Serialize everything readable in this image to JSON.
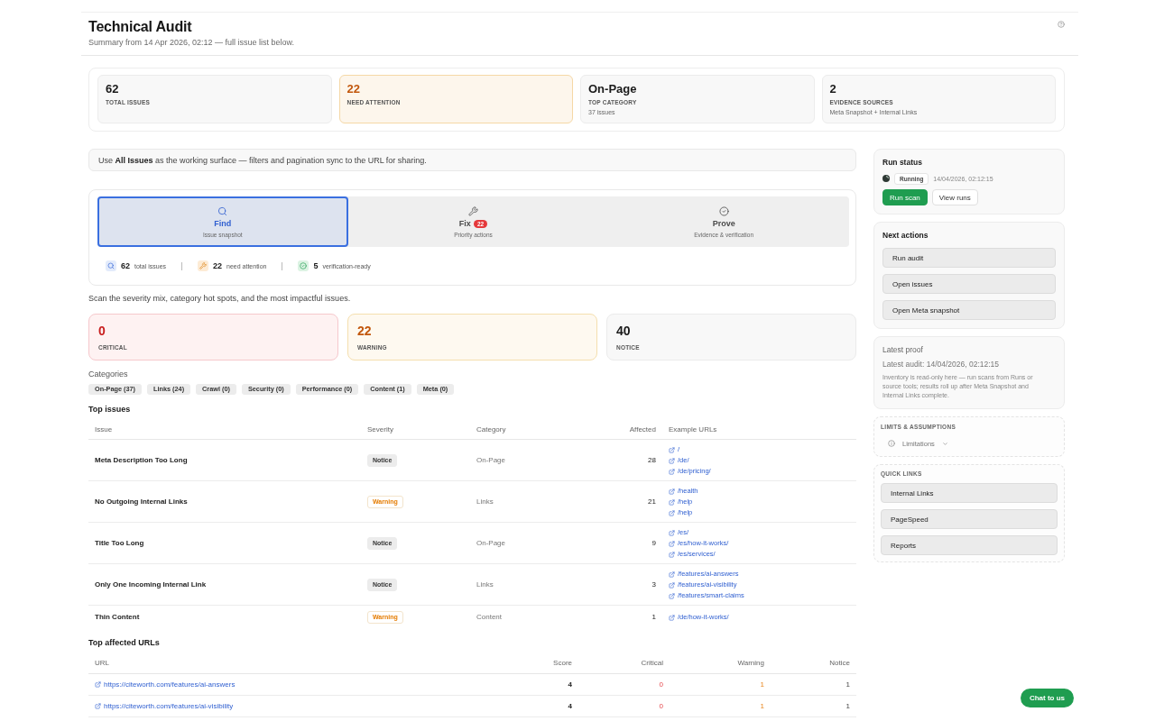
{
  "header": {
    "title": "Technical Audit",
    "subtitle": "Summary from 14 Apr 2026, 02:12 — full issue list below."
  },
  "summary_cards": [
    {
      "kind": "plain",
      "value": "62",
      "label": "TOTAL ISSUES"
    },
    {
      "kind": "attention",
      "value": "22",
      "label": "NEED ATTENTION"
    },
    {
      "kind": "plain",
      "value": "On-Page",
      "label": "TOP CATEGORY",
      "note": "37 issues"
    },
    {
      "kind": "plain",
      "value": "2",
      "label": "EVIDENCE SOURCES",
      "note": "Meta Snapshot + Internal Links"
    }
  ],
  "banner": "Use **All Issues** as the working surface — filters and pagination sync to the URL for sharing.",
  "workflow": {
    "tabs": [
      {
        "kind": "find",
        "label": "Find",
        "sublabel": "Issue snapshot",
        "selected": true
      },
      {
        "kind": "fix",
        "label": "Fix",
        "badge": "22",
        "sublabel": "Priority actions",
        "selected": false
      },
      {
        "kind": "prove",
        "label": "Prove",
        "sublabel": "Evidence & verification",
        "selected": false
      }
    ],
    "stats": [
      {
        "kind": "issues",
        "value": "62",
        "label": "total issues"
      },
      {
        "kind": "attention",
        "value": "22",
        "label": "need attention"
      },
      {
        "kind": "verified",
        "value": "5",
        "label": "verification-ready"
      }
    ]
  },
  "intro": "Scan the severity mix, category hot spots, and the most impactful issues.",
  "severity_cards": [
    {
      "kind": "critical",
      "value": "0",
      "label": "CRITICAL"
    },
    {
      "kind": "warning",
      "value": "22",
      "label": "WARNING"
    },
    {
      "kind": "notice",
      "value": "40",
      "label": "NOTICE"
    }
  ],
  "categories": {
    "title": "Categories",
    "chips": [
      "On-Page (37)",
      "Links (24)",
      "Crawl (0)",
      "Security (0)",
      "Performance (0)",
      "Content (1)",
      "Meta (0)"
    ]
  },
  "top_issues": {
    "title": "Top issues",
    "columns": [
      "Issue",
      "Severity",
      "Category",
      "Affected",
      "Example URLs"
    ],
    "rows": [
      {
        "issue": "Meta Description Too Long",
        "severity": {
          "kind": "notice",
          "label": "Notice"
        },
        "category": "On-Page",
        "affected": "28",
        "urls": [
          "/",
          "/de/",
          "/de/pricing/"
        ]
      },
      {
        "issue": "No Outgoing Internal Links",
        "severity": {
          "kind": "warning",
          "label": "Warning"
        },
        "category": "Links",
        "affected": "21",
        "urls": [
          "/health",
          "/help",
          "/help"
        ]
      },
      {
        "issue": "Title Too Long",
        "severity": {
          "kind": "notice",
          "label": "Notice"
        },
        "category": "On-Page",
        "affected": "9",
        "urls": [
          "/es/",
          "/es/how-it-works/",
          "/es/services/"
        ]
      },
      {
        "issue": "Only One Incoming Internal Link",
        "severity": {
          "kind": "notice",
          "label": "Notice"
        },
        "category": "Links",
        "affected": "3",
        "urls": [
          "/features/ai-answers",
          "/features/ai-visibility",
          "/features/smart-claims"
        ]
      },
      {
        "issue": "Thin Content",
        "severity": {
          "kind": "warning",
          "label": "Warning"
        },
        "category": "Content",
        "affected": "1",
        "urls": [
          "/de/how-it-works/"
        ]
      }
    ]
  },
  "top_urls": {
    "title": "Top affected URLs",
    "columns": [
      "URL",
      "Score",
      "Critical",
      "Warning",
      "Notice"
    ],
    "rows": [
      {
        "url": "https://citeworth.com/features/ai-answers",
        "score": "4",
        "critical": "0",
        "warning": "1",
        "notice": "1"
      },
      {
        "url": "https://citeworth.com/features/ai-visibility",
        "score": "4",
        "critical": "0",
        "warning": "1",
        "notice": "1"
      }
    ]
  },
  "sidebar": {
    "run_status": {
      "title": "Run status",
      "status": "Running",
      "timestamp": "14/04/2026, 02:12:15",
      "buttons": [
        {
          "kind": "primary",
          "label": "Run scan"
        },
        {
          "kind": "secondary",
          "label": "View runs"
        }
      ]
    },
    "next_actions": {
      "title": "Next actions",
      "buttons": [
        "Run audit",
        "Open issues",
        "Open Meta snapshot"
      ]
    },
    "latest_proof": {
      "title": "Latest proof",
      "latest_audit": "Latest audit: 14/04/2026, 02:12:15",
      "note": "Inventory is read-only here — run scans from Runs or source tools; results roll up after Meta Snapshot and Internal Links complete."
    },
    "limits": {
      "title": "LIMITS & ASSUMPTIONS",
      "toggle": "Limitations",
      "expanded": false
    },
    "quick_links": {
      "title": "QUICK LINKS",
      "links": [
        "Internal Links",
        "PageSpeed",
        "Reports"
      ]
    }
  },
  "chat_button": "Chat to us"
}
